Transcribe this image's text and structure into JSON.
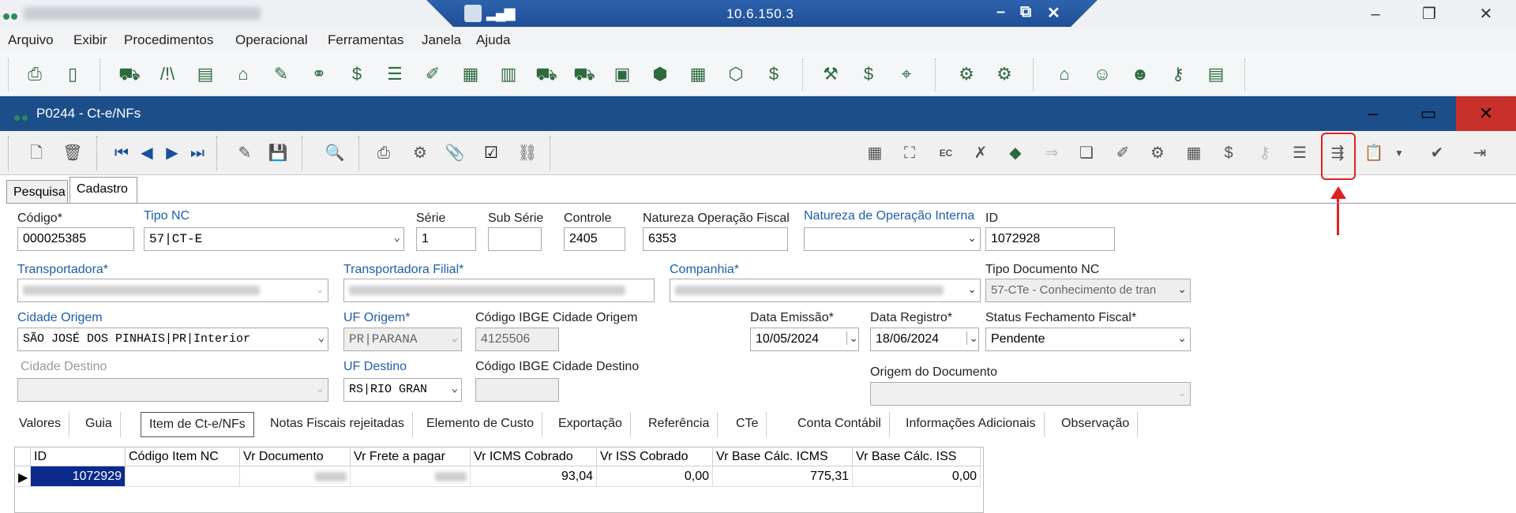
{
  "rdp": {
    "ip": "10.6.150.3"
  },
  "menu": [
    "Arquivo",
    "Exibir",
    "Procedimentos",
    "Operacional",
    "Ferramentas",
    "Janela",
    "Ajuda"
  ],
  "window": {
    "title": "P0244 - Ct-e/NFs"
  },
  "tabs": {
    "pesquisa": "Pesquisa",
    "cadastro": "Cadastro"
  },
  "form": {
    "codigo": {
      "label": "Código*",
      "value": "000025385"
    },
    "tipo_nc": {
      "label": "Tipo NC",
      "value": "57|CT-E"
    },
    "serie": {
      "label": "Série",
      "value": "1"
    },
    "sub_serie": {
      "label": "Sub Série",
      "value": ""
    },
    "controle": {
      "label": "Controle",
      "value": "2405"
    },
    "natureza_fiscal": {
      "label": "Natureza Operação Fiscal",
      "value": "6353"
    },
    "natureza_interna": {
      "label": "Natureza de Operação Interna",
      "value": ""
    },
    "id": {
      "label": "ID",
      "value": "1072928"
    },
    "transportadora": {
      "label": "Transportadora*"
    },
    "transportadora_filial": {
      "label": "Transportadora Filial*"
    },
    "companhia": {
      "label": "Companhia*"
    },
    "tipo_documento": {
      "label": "Tipo Documento NC",
      "value": "57-CTe - Conhecimento de tran"
    },
    "cidade_origem": {
      "label": "Cidade Origem",
      "value": "SÃO JOSÉ DOS PINHAIS|PR|Interior"
    },
    "uf_origem": {
      "label": "UF Origem*",
      "value": "PR|PARANA"
    },
    "ibge_origem": {
      "label": "Código IBGE Cidade Origem",
      "value": "4125506"
    },
    "data_emissao": {
      "label": "Data Emissão*",
      "value": "10/05/2024"
    },
    "data_registro": {
      "label": "Data Registro*",
      "value": "18/06/2024"
    },
    "status_fechamento": {
      "label": "Status Fechamento Fiscal*",
      "value": "Pendente"
    },
    "cidade_destino": {
      "label": "Cidade Destino",
      "value": ""
    },
    "uf_destino": {
      "label": "UF Destino",
      "value": "RS|RIO GRAN"
    },
    "ibge_destino": {
      "label": "Código IBGE Cidade Destino",
      "value": ""
    },
    "origem_documento": {
      "label": "Origem do Documento",
      "value": ""
    }
  },
  "bottom_tabs": [
    "Valores",
    "Guia",
    "Item de Ct-e/NFs",
    "Notas Fiscais rejeitadas",
    "Elemento de Custo",
    "Exportação",
    "Referência",
    "CTe",
    "Conta Contábil",
    "Informações Adicionais",
    "Observação"
  ],
  "grid": {
    "headers": [
      "ID",
      "Código Item NC",
      "Vr Documento",
      "Vr Frete a pagar",
      "Vr ICMS Cobrado",
      "Vr ISS Cobrado",
      "Vr Base Cálc. ICMS",
      "Vr Base Cálc. ISS"
    ],
    "row": {
      "id": "1072929",
      "codigo_item": "",
      "vr_icms": "93,04",
      "vr_iss": "0,00",
      "base_icms": "775,31",
      "base_iss": "0,00"
    }
  },
  "colors": {
    "title_blue": "#1c4e8a",
    "highlight": "#e02020",
    "selection": "#0b2a8c"
  }
}
